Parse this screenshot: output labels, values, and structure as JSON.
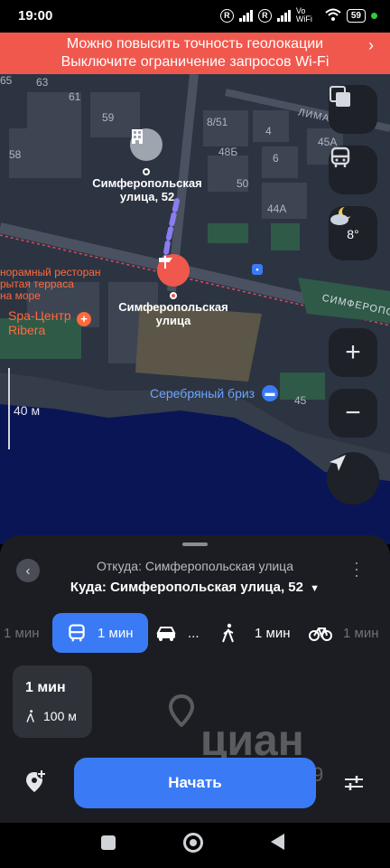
{
  "status": {
    "time": "19:00",
    "network": "Vo WiFi",
    "battery": "59"
  },
  "banner": {
    "line1": "Можно повысить точность геолокации",
    "line2": "Выключите ограничение запросов Wi-Fi"
  },
  "map": {
    "house_numbers": [
      "65",
      "63",
      "61",
      "59",
      "58",
      "8/51",
      "48Б",
      "50",
      "44А",
      "45А",
      "6",
      "4",
      "45"
    ],
    "street_lima": "ЛИМА",
    "street_simf": "СИМФЕРОПО",
    "point_a": {
      "line1": "Симферопольская",
      "line2": "улица, 52"
    },
    "point_b": {
      "line1": "Симферопольская",
      "line2": "улица"
    },
    "restaurant": {
      "line1": "норамный ресторан",
      "line2": "рытая терраса",
      "line3": "на море"
    },
    "spa": {
      "line1": "Spa-Центр",
      "line2": "Ribera"
    },
    "hotel": "Серебряный бриз",
    "scale": "40 м",
    "weather_temp": "8°",
    "watermark": "циан",
    "watermark_id": "ID:327588049"
  },
  "route": {
    "from": "Откуда: Симферопольская улица",
    "to": "Куда: Симферопольская улица, 52",
    "modes": [
      {
        "icon": "car-icon",
        "label": "1 мин"
      },
      {
        "icon": "bus-icon",
        "label": "1 мин",
        "active": true
      },
      {
        "icon": "taxi-icon",
        "label": "..."
      },
      {
        "icon": "walk-icon",
        "label": "1 мин"
      },
      {
        "icon": "bike-icon",
        "label": "1 мин"
      }
    ],
    "card_time": "1 мин",
    "card_distance": "100 м",
    "start_label": "Начать"
  },
  "colors": {
    "accent": "#3a7bf5",
    "banner": "#f0584e",
    "route": "#8b7cf0",
    "pin": "#f0584e"
  }
}
